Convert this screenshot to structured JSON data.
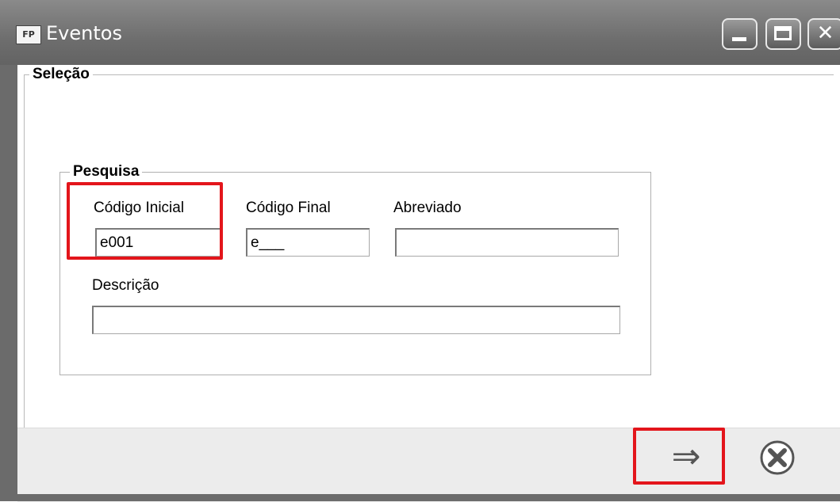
{
  "window": {
    "app_icon_text": "FP",
    "title": "Eventos"
  },
  "selection_group": {
    "title": "Seleção"
  },
  "search_group": {
    "title": "Pesquisa",
    "fields": {
      "codigo_inicial": {
        "label": "Código Inicial",
        "value": "e001"
      },
      "codigo_final": {
        "label": "Código Final",
        "value": "e___"
      },
      "abreviado": {
        "label": "Abreviado",
        "value": ""
      },
      "descricao": {
        "label": "Descrição",
        "value": ""
      }
    }
  },
  "footer": {
    "confirm_icon": "arrow-right-icon",
    "cancel_icon": "cancel-circle-icon"
  },
  "colors": {
    "highlight": "#e3151b",
    "titlebar": "#6e6e6e"
  }
}
